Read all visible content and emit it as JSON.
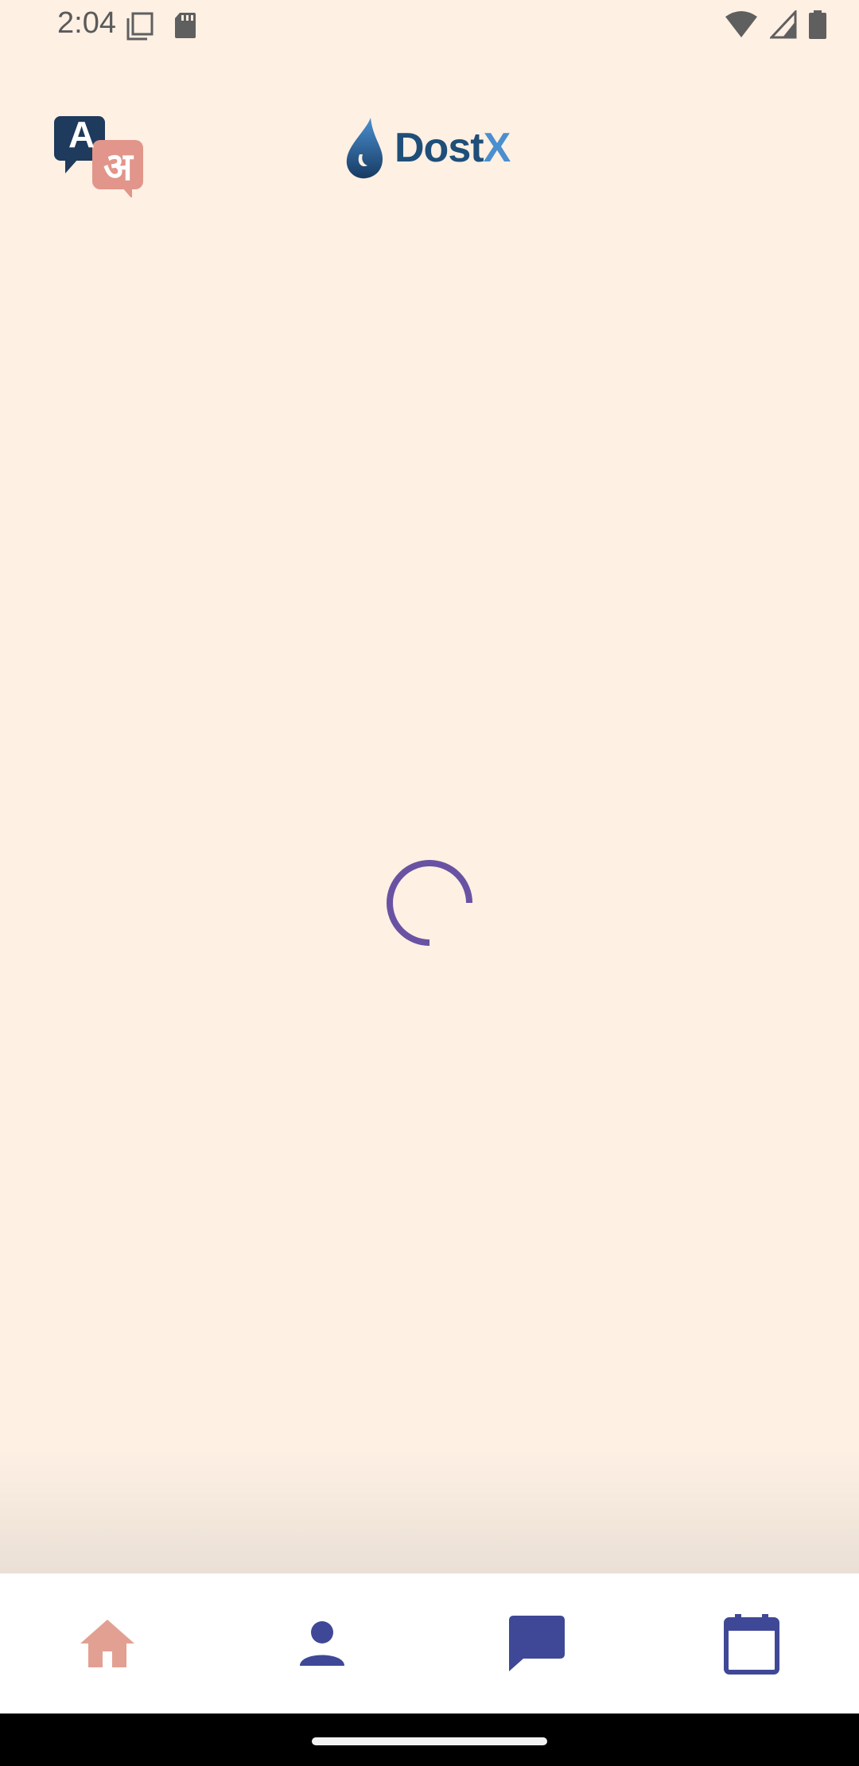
{
  "status_bar": {
    "time": "2:04",
    "icons": [
      "screenshot-icon",
      "sd-card-icon",
      "wifi-icon",
      "cell-signal-icon",
      "battery-icon"
    ]
  },
  "header": {
    "language_button_icon": "translate-icon",
    "language_glyphs": {
      "latin": "A",
      "devanagari": "अ"
    },
    "logo": {
      "part1": "Dost",
      "part2": "X"
    }
  },
  "content": {
    "state": "loading",
    "spinner_color": "#6A52A3"
  },
  "bottom_nav": {
    "items": [
      {
        "icon": "home-icon",
        "active": true,
        "color": "#E2A093"
      },
      {
        "icon": "person-icon",
        "active": false,
        "color": "#3F4896"
      },
      {
        "icon": "chat-icon",
        "active": false,
        "color": "#3F4896"
      },
      {
        "icon": "calendar-icon",
        "active": false,
        "color": "#3F4896"
      }
    ]
  },
  "colors": {
    "background": "#FEF0E3",
    "brand_dark": "#1F4E79",
    "brand_light": "#4A8FCF",
    "nav_active": "#E2A093",
    "nav_inactive": "#3F4896"
  }
}
